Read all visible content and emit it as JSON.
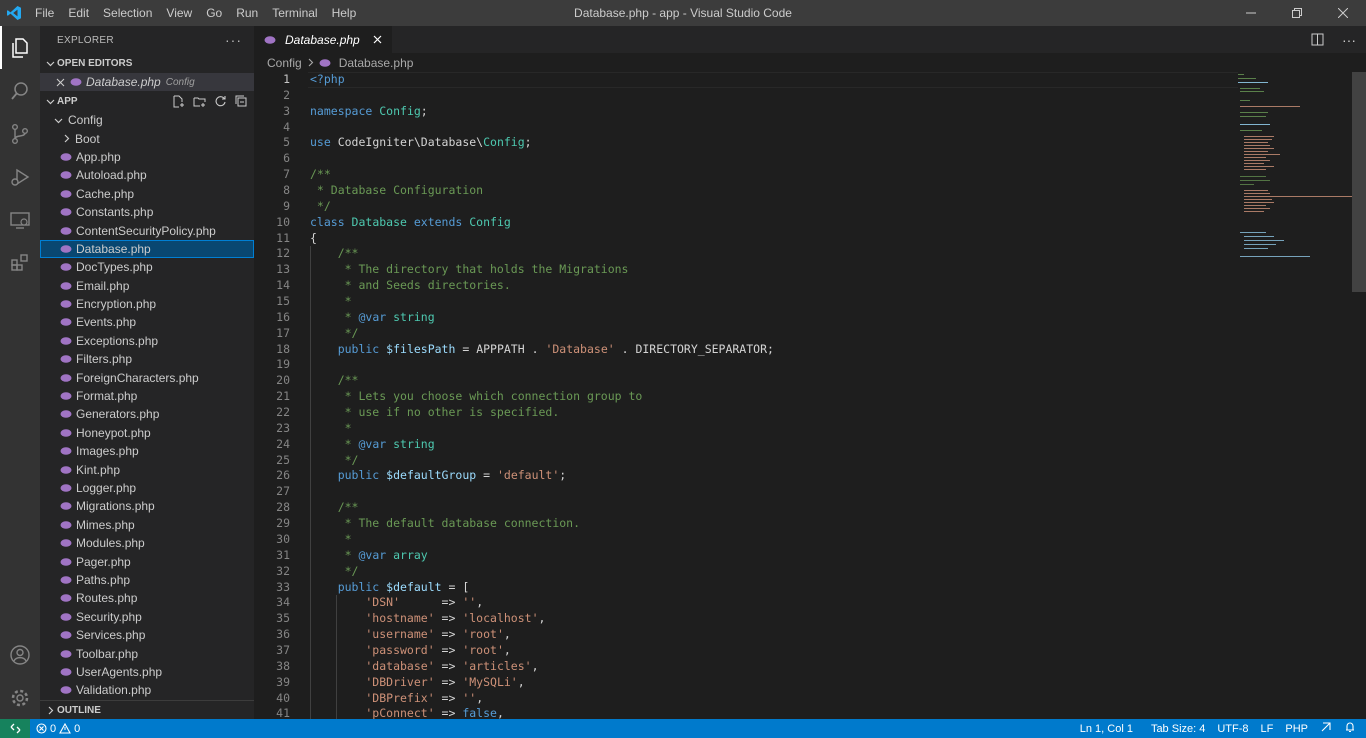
{
  "titlebar": {
    "window_title": "Database.php - app - Visual Studio Code",
    "menu": [
      "File",
      "Edit",
      "Selection",
      "View",
      "Go",
      "Run",
      "Terminal",
      "Help"
    ]
  },
  "sidebar": {
    "title": "EXPLORER",
    "open_editors_label": "OPEN EDITORS",
    "open_editor": {
      "name": "Database.php",
      "desc": "Config"
    },
    "app_label": "APP",
    "folder_config": "Config",
    "folder_boot": "Boot",
    "files": [
      "App.php",
      "Autoload.php",
      "Cache.php",
      "Constants.php",
      "ContentSecurityPolicy.php",
      "Database.php",
      "DocTypes.php",
      "Email.php",
      "Encryption.php",
      "Events.php",
      "Exceptions.php",
      "Filters.php",
      "ForeignCharacters.php",
      "Format.php",
      "Generators.php",
      "Honeypot.php",
      "Images.php",
      "Kint.php",
      "Logger.php",
      "Migrations.php",
      "Mimes.php",
      "Modules.php",
      "Pager.php",
      "Paths.php",
      "Routes.php",
      "Security.php",
      "Services.php",
      "Toolbar.php",
      "UserAgents.php",
      "Validation.php"
    ],
    "selected_file": "Database.php",
    "outline_label": "OUTLINE"
  },
  "editor": {
    "tab_label": "Database.php",
    "breadcrumb": {
      "folder": "Config",
      "file": "Database.php"
    }
  },
  "code_lines": [
    [
      [
        "k",
        "<?php"
      ]
    ],
    [],
    [
      [
        "k",
        "namespace "
      ],
      [
        "t",
        "Config"
      ],
      [
        "d",
        ";"
      ]
    ],
    [],
    [
      [
        "k",
        "use "
      ],
      [
        "d",
        "CodeIgniter\\Database\\"
      ],
      [
        "t",
        "Config"
      ],
      [
        "d",
        ";"
      ]
    ],
    [],
    [
      [
        "c",
        "/**"
      ]
    ],
    [
      [
        "c",
        " * Database Configuration"
      ]
    ],
    [
      [
        "c",
        " */"
      ]
    ],
    [
      [
        "k",
        "class "
      ],
      [
        "t",
        "Database "
      ],
      [
        "k",
        "extends "
      ],
      [
        "t",
        "Config"
      ]
    ],
    [
      [
        "d",
        "{"
      ]
    ],
    [
      [
        "c",
        "    /**"
      ]
    ],
    [
      [
        "c",
        "     * The directory that holds the Migrations"
      ]
    ],
    [
      [
        "c",
        "     * and Seeds directories."
      ]
    ],
    [
      [
        "c",
        "     *"
      ]
    ],
    [
      [
        "c",
        "     * "
      ],
      [
        "k",
        "@var "
      ],
      [
        "t",
        "string"
      ]
    ],
    [
      [
        "c",
        "     */"
      ]
    ],
    [
      [
        "k",
        "    public "
      ],
      [
        "v",
        "$filesPath"
      ],
      [
        "d",
        " = APPPATH . "
      ],
      [
        "s",
        "'Database'"
      ],
      [
        "d",
        " . DIRECTORY_SEPARATOR;"
      ]
    ],
    [],
    [
      [
        "c",
        "    /**"
      ]
    ],
    [
      [
        "c",
        "     * Lets you choose which connection group to"
      ]
    ],
    [
      [
        "c",
        "     * use if no other is specified."
      ]
    ],
    [
      [
        "c",
        "     *"
      ]
    ],
    [
      [
        "c",
        "     * "
      ],
      [
        "k",
        "@var "
      ],
      [
        "t",
        "string"
      ]
    ],
    [
      [
        "c",
        "     */"
      ]
    ],
    [
      [
        "k",
        "    public "
      ],
      [
        "v",
        "$defaultGroup"
      ],
      [
        "d",
        " = "
      ],
      [
        "s",
        "'default'"
      ],
      [
        "d",
        ";"
      ]
    ],
    [],
    [
      [
        "c",
        "    /**"
      ]
    ],
    [
      [
        "c",
        "     * The default database connection."
      ]
    ],
    [
      [
        "c",
        "     *"
      ]
    ],
    [
      [
        "c",
        "     * "
      ],
      [
        "k",
        "@var "
      ],
      [
        "t",
        "array"
      ]
    ],
    [
      [
        "c",
        "     */"
      ]
    ],
    [
      [
        "k",
        "    public "
      ],
      [
        "v",
        "$default"
      ],
      [
        "d",
        " = ["
      ]
    ],
    [
      [
        "s",
        "        'DSN'"
      ],
      [
        "d",
        "      => "
      ],
      [
        "s",
        "''"
      ],
      [
        "d",
        ","
      ]
    ],
    [
      [
        "s",
        "        'hostname'"
      ],
      [
        "d",
        " => "
      ],
      [
        "s",
        "'localhost'"
      ],
      [
        "d",
        ","
      ]
    ],
    [
      [
        "s",
        "        'username'"
      ],
      [
        "d",
        " => "
      ],
      [
        "s",
        "'root'"
      ],
      [
        "d",
        ","
      ]
    ],
    [
      [
        "s",
        "        'password'"
      ],
      [
        "d",
        " => "
      ],
      [
        "s",
        "'root'"
      ],
      [
        "d",
        ","
      ]
    ],
    [
      [
        "s",
        "        'database'"
      ],
      [
        "d",
        " => "
      ],
      [
        "s",
        "'articles'"
      ],
      [
        "d",
        ","
      ]
    ],
    [
      [
        "s",
        "        'DBDriver'"
      ],
      [
        "d",
        " => "
      ],
      [
        "s",
        "'MySQLi'"
      ],
      [
        "d",
        ","
      ]
    ],
    [
      [
        "s",
        "        'DBPrefix'"
      ],
      [
        "d",
        " => "
      ],
      [
        "s",
        "''"
      ],
      [
        "d",
        ","
      ]
    ],
    [
      [
        "s",
        "        'pConnect'"
      ],
      [
        "d",
        " => "
      ],
      [
        "k",
        "false"
      ],
      [
        "d",
        ","
      ]
    ]
  ],
  "statusbar": {
    "errors": "0",
    "warnings": "0",
    "position": "Ln 1, Col 1",
    "tab_size": "Tab Size: 4",
    "encoding": "UTF-8",
    "eol": "LF",
    "language": "PHP"
  },
  "colors": {
    "accent": "#007acc",
    "selection": "#094771",
    "php_icon": "#a074c4"
  }
}
